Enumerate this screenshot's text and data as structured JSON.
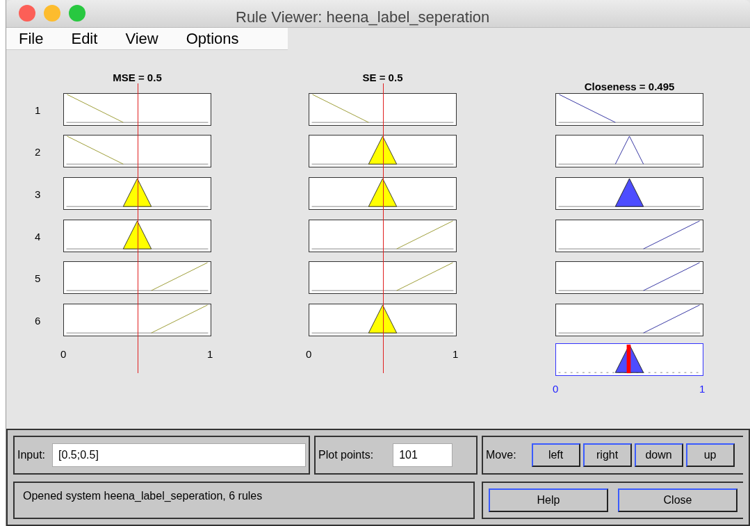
{
  "window": {
    "title": "Rule Viewer: heena_label_seperation"
  },
  "menu": [
    "File",
    "Edit",
    "View",
    "Options"
  ],
  "variables": [
    {
      "kind": "input",
      "title": "MSE = 0.5",
      "level": 0.5,
      "axis": [
        "0",
        "1"
      ]
    },
    {
      "kind": "input",
      "title": "SE = 0.5",
      "level": 0.5,
      "axis": [
        "0",
        "1"
      ]
    },
    {
      "kind": "output",
      "title": "Closeness = 0.495",
      "level": 0.495,
      "axis": [
        "0",
        "1"
      ]
    }
  ],
  "rules": [
    {
      "label": "1",
      "cells": [
        {
          "kind": "decreasing",
          "filled": false
        },
        {
          "kind": "decreasing",
          "filled": false
        },
        {
          "kind": "decreasing",
          "filled": false
        }
      ]
    },
    {
      "label": "2",
      "cells": [
        {
          "kind": "decreasing",
          "filled": false
        },
        {
          "kind": "triangle",
          "filled": true
        },
        {
          "kind": "triangle",
          "filled": false
        }
      ]
    },
    {
      "label": "3",
      "cells": [
        {
          "kind": "triangle",
          "filled": true
        },
        {
          "kind": "triangle",
          "filled": true
        },
        {
          "kind": "triangle",
          "filled": true
        }
      ]
    },
    {
      "label": "4",
      "cells": [
        {
          "kind": "triangle",
          "filled": true
        },
        {
          "kind": "increasing",
          "filled": false
        },
        {
          "kind": "increasing",
          "filled": false
        }
      ]
    },
    {
      "label": "5",
      "cells": [
        {
          "kind": "increasing",
          "filled": false
        },
        {
          "kind": "increasing",
          "filled": false
        },
        {
          "kind": "increasing",
          "filled": false
        }
      ]
    },
    {
      "label": "6",
      "cells": [
        {
          "kind": "increasing",
          "filled": false
        },
        {
          "kind": "triangle",
          "filled": true
        },
        {
          "kind": "increasing",
          "filled": false
        }
      ]
    }
  ],
  "input": {
    "label": "Input:",
    "value": "[0.5;0.5]"
  },
  "plot_points": {
    "label": "Plot points:",
    "value": "101"
  },
  "move": {
    "label": "Move:",
    "buttons": [
      "left",
      "right",
      "down",
      "up"
    ]
  },
  "status": "Opened system heena_label_seperation, 6 rules",
  "buttons": [
    "Help",
    "Close"
  ]
}
